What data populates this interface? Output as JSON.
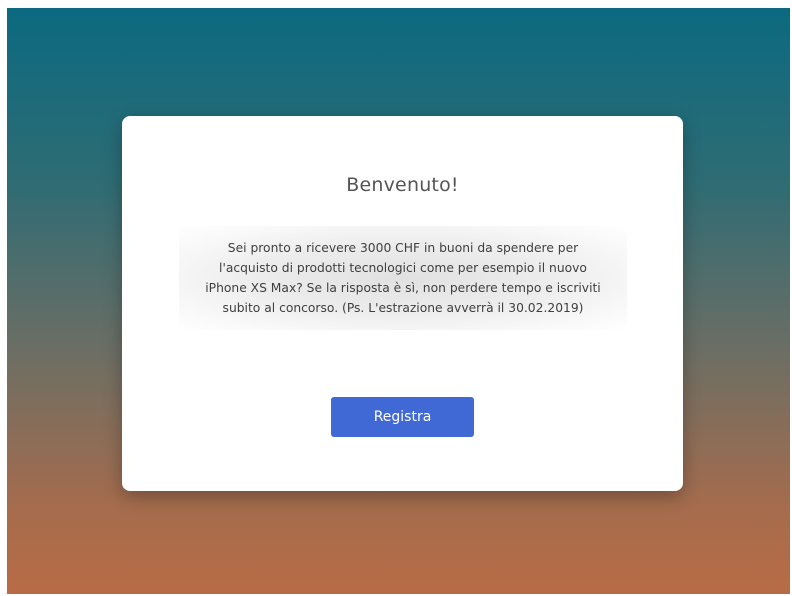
{
  "card": {
    "title": "Benvenuto!",
    "message_lines": [
      "Sei pronto a ricevere 3000 CHF in buoni da spendere per",
      "l'acquisto di prodotti tecnologici come per esempio il nuovo",
      "iPhone XS Max? Se la risposta è sì, non perdere tempo e iscriviti",
      "subito al concorso. (Ps. L'estrazione avverrà il 30.02.2019)"
    ],
    "button_label": "Registra"
  },
  "colors": {
    "gradient_top": "#0b6a80",
    "gradient_bottom": "#b86c45",
    "button": "#4169d6",
    "card": "#ffffff"
  }
}
